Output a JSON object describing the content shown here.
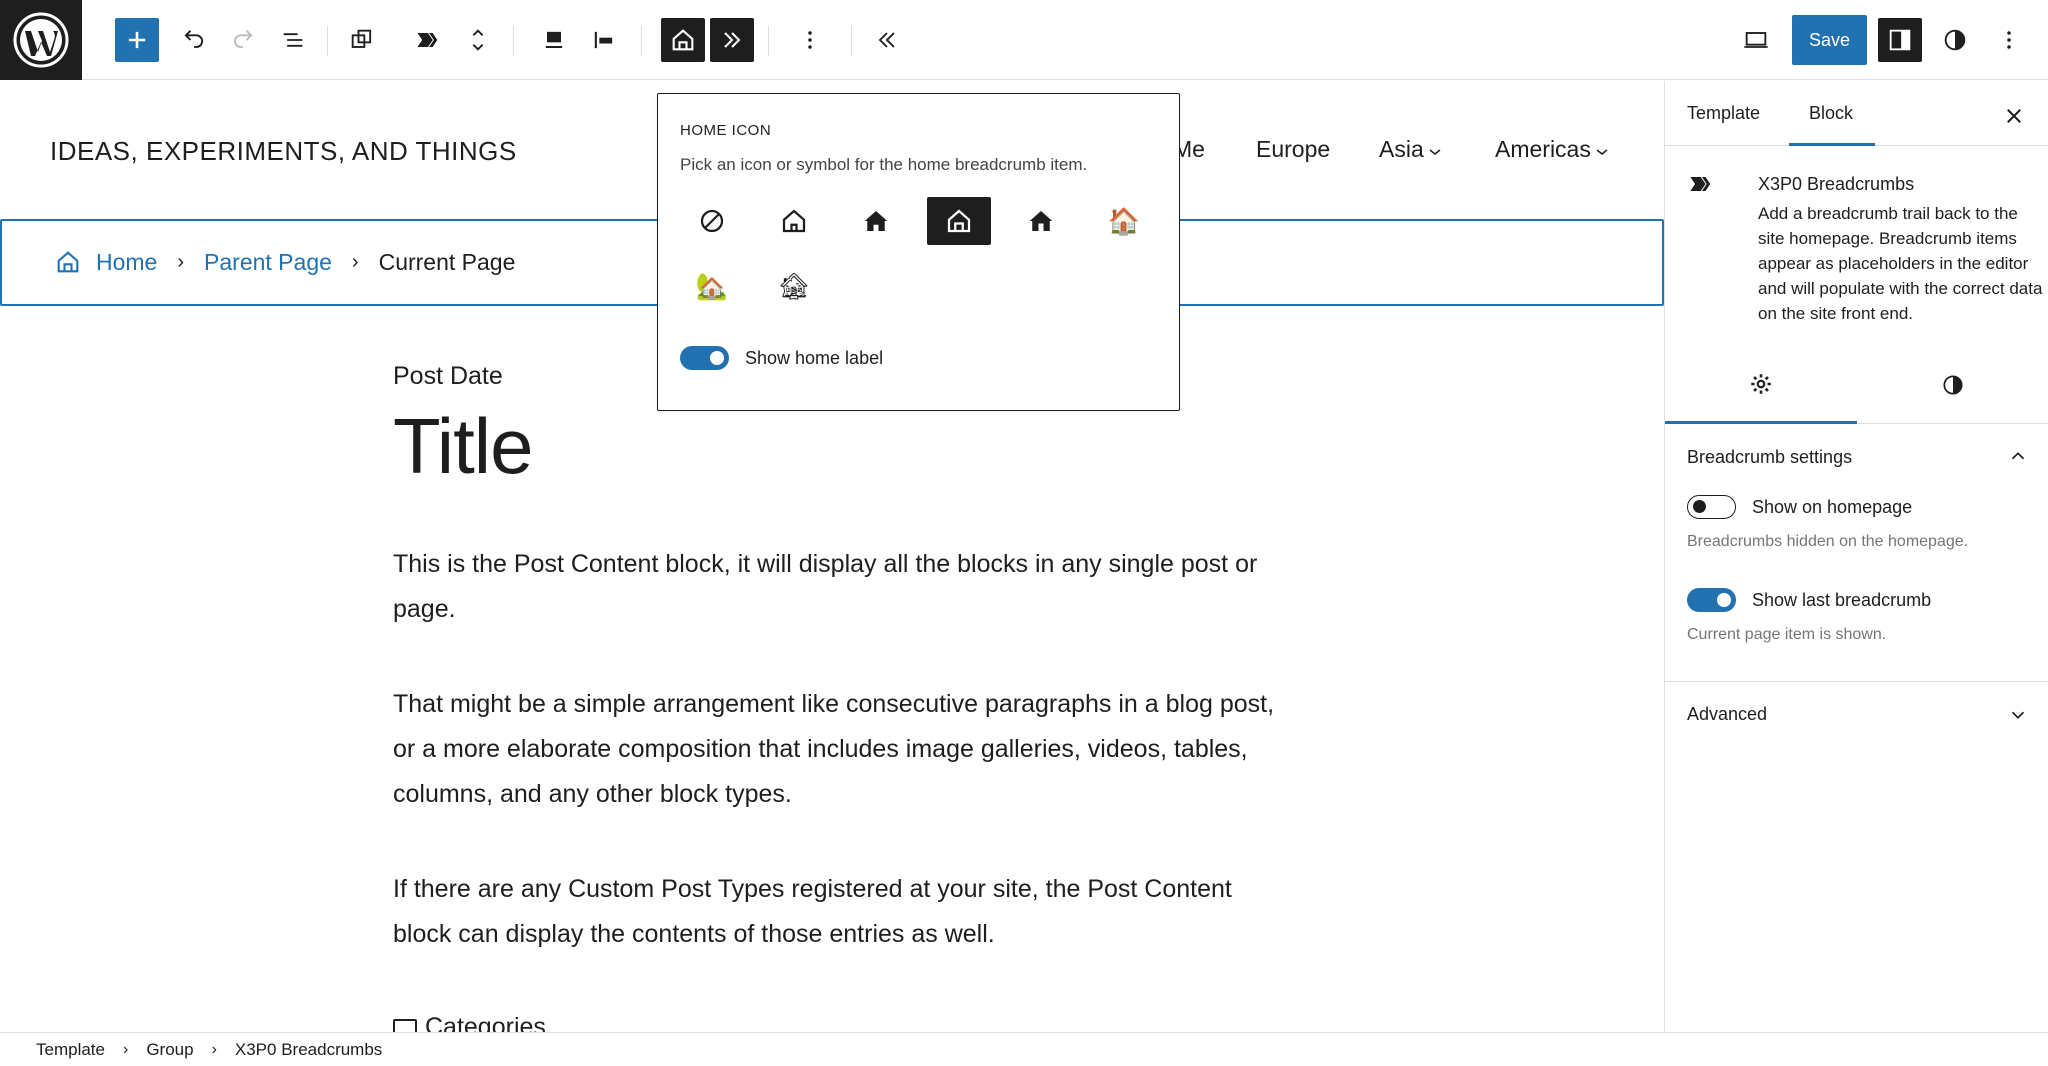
{
  "toolbar": {
    "save_label": "Save"
  },
  "site": {
    "title": "IDEAS, EXPERIMENTS, AND THINGS",
    "nav": [
      {
        "label": "Me",
        "has_submenu": false
      },
      {
        "label": "Europe",
        "has_submenu": false
      },
      {
        "label": "Asia",
        "has_submenu": true
      },
      {
        "label": "Americas",
        "has_submenu": true
      }
    ]
  },
  "breadcrumbs": {
    "home": "Home",
    "parent": "Parent Page",
    "current": "Current Page",
    "separator": "›"
  },
  "post": {
    "date": "Post Date",
    "title": "Title",
    "paragraphs": [
      "This is the Post Content block, it will display all the blocks in any single post or page.",
      "That might be a simple arrangement like consecutive paragraphs in a blog post, or a more elaborate composition that includes image galleries, videos, tables, columns, and any other block types.",
      "If there are any Custom Post Types registered at your site, the Post Content block can display the contents of those entries as well."
    ],
    "categories": "Categories"
  },
  "popover": {
    "heading": "HOME ICON",
    "help": "Pick an icon or symbol for the home breadcrumb item.",
    "icons": [
      "none",
      "house-outline",
      "house-solid",
      "house-outline-door",
      "house-solid-door",
      "🏠",
      "🏡",
      "🏚"
    ],
    "selected_index": 3,
    "toggle_label": "Show home label",
    "toggle_on": true
  },
  "sidebar": {
    "tabs": [
      "Template",
      "Block"
    ],
    "active_tab": "Block",
    "block_name": "X3P0 Breadcrumbs",
    "block_desc": "Add a breadcrumb trail back to the site homepage. Breadcrumb items appear as placeholders in the editor and will populate with the correct data on the site front end.",
    "settings_title": "Breadcrumb settings",
    "show_on_homepage": {
      "label": "Show on homepage",
      "help": "Breadcrumbs hidden on the homepage.",
      "on": false
    },
    "show_last": {
      "label": "Show last breadcrumb",
      "help": "Current page item is shown.",
      "on": true
    },
    "advanced": "Advanced"
  },
  "footer_crumbs": [
    "Template",
    "Group",
    "X3P0 Breadcrumbs"
  ],
  "colors": {
    "accent": "#2271b1",
    "dark": "#1e1e1e"
  }
}
